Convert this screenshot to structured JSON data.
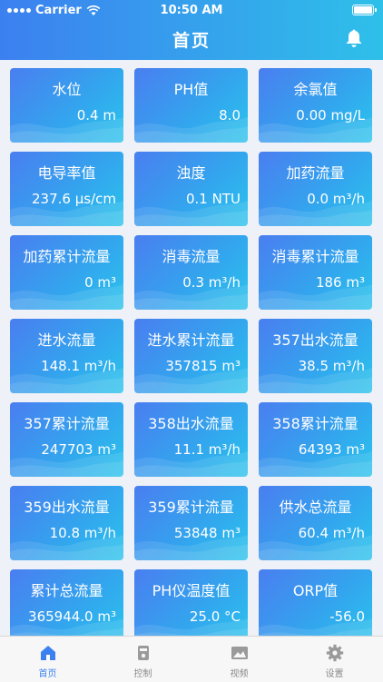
{
  "status": {
    "carrier": "Carrier",
    "time": "10:50 AM"
  },
  "nav": {
    "title": "首页",
    "bell_icon": "bell-icon"
  },
  "cards": [
    {
      "label": "水位",
      "value": "0.4 m"
    },
    {
      "label": "PH值",
      "value": "8.0"
    },
    {
      "label": "余氯值",
      "value": "0.00 mg/L"
    },
    {
      "label": "电导率值",
      "value": "237.6 μs/cm"
    },
    {
      "label": "浊度",
      "value": "0.1 NTU"
    },
    {
      "label": "加药流量",
      "value": "0.0 m³/h"
    },
    {
      "label": "加药累计流量",
      "value": "0 m³"
    },
    {
      "label": "消毒流量",
      "value": "0.3 m³/h"
    },
    {
      "label": "消毒累计流量",
      "value": "186 m³"
    },
    {
      "label": "进水流量",
      "value": "148.1 m³/h"
    },
    {
      "label": "进水累计流量",
      "value": "357815 m³"
    },
    {
      "label": "357出水流量",
      "value": "38.5 m³/h"
    },
    {
      "label": "357累计流量",
      "value": "247703 m³"
    },
    {
      "label": "358出水流量",
      "value": "11.1 m³/h"
    },
    {
      "label": "358累计流量",
      "value": "64393 m³"
    },
    {
      "label": "359出水流量",
      "value": "10.8 m³/h"
    },
    {
      "label": "359累计流量",
      "value": "53848 m³"
    },
    {
      "label": "供水总流量",
      "value": "60.4 m³/h"
    },
    {
      "label": "累计总流量",
      "value": "365944.0 m³"
    },
    {
      "label": "PH仪温度值",
      "value": "25.0 °C"
    },
    {
      "label": "ORP值",
      "value": "-56.0"
    }
  ],
  "tabs": [
    {
      "label": "首页",
      "icon": "home-icon",
      "active": true
    },
    {
      "label": "控制",
      "icon": "control-icon",
      "active": false
    },
    {
      "label": "视频",
      "icon": "video-icon",
      "active": false
    },
    {
      "label": "设置",
      "icon": "gear-icon",
      "active": false
    }
  ],
  "colors": {
    "accent": "#3b82f0",
    "gradient_start": "#3c80f0",
    "gradient_end": "#2ec0e9"
  }
}
